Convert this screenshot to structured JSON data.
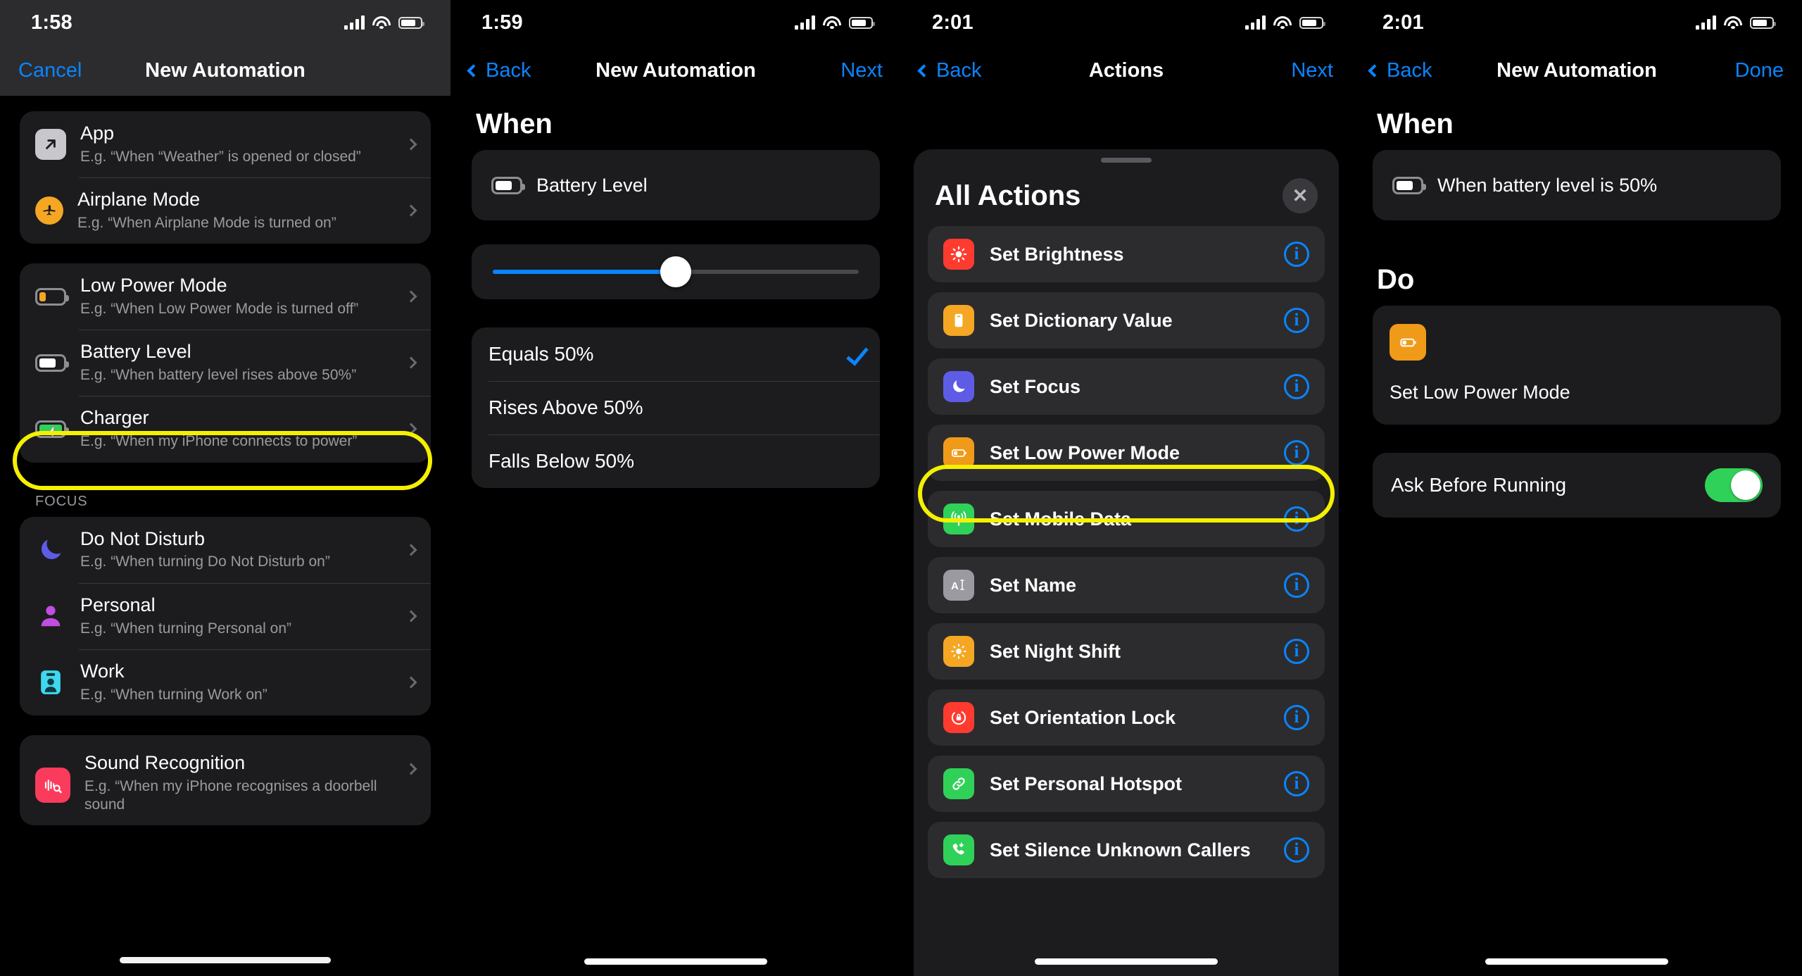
{
  "panels": [
    {
      "status": {
        "time": "1:58"
      },
      "nav": {
        "left": "Cancel",
        "title": "New Automation",
        "right": ""
      },
      "groups": [
        {
          "header": "",
          "rows": [
            {
              "icon": "arrow-up-right-square-icon",
              "title": "App",
              "sub": "E.g. “When “Weather” is opened or closed”"
            },
            {
              "icon": "airplane-icon",
              "title": "Airplane Mode",
              "sub": "E.g. “When Airplane Mode is turned on”"
            }
          ]
        },
        {
          "header": "",
          "rows": [
            {
              "icon": "battery-low-icon",
              "title": "Low Power Mode",
              "sub": "E.g. “When Low Power Mode is turned off”"
            },
            {
              "icon": "battery-level-icon",
              "title": "Battery Level",
              "sub": "E.g. “When battery level rises above 50%”",
              "highlighted": true
            },
            {
              "icon": "battery-charging-icon",
              "title": "Charger",
              "sub": "E.g. “When my iPhone connects to power”"
            }
          ]
        },
        {
          "header": "FOCUS",
          "rows": [
            {
              "icon": "moon-icon",
              "title": "Do Not Disturb",
              "sub": "E.g. “When turning Do Not Disturb on”"
            },
            {
              "icon": "person-icon",
              "title": "Personal",
              "sub": "E.g. “When turning Personal on”"
            },
            {
              "icon": "id-card-icon",
              "title": "Work",
              "sub": "E.g. “When turning Work on”"
            }
          ]
        },
        {
          "header": "",
          "rows": [
            {
              "icon": "waveform-magnifier-icon",
              "title": "Sound Recognition",
              "sub": "E.g. “When my iPhone recognises a doorbell sound"
            }
          ]
        }
      ]
    },
    {
      "status": {
        "time": "1:59"
      },
      "nav": {
        "left": "Back",
        "title": "New Automation",
        "right": "Next"
      },
      "section_title": "When",
      "trigger": {
        "icon": "battery-level-icon",
        "label": "Battery Level"
      },
      "slider": {
        "value": 50,
        "min": 0,
        "max": 100
      },
      "options": [
        {
          "label": "Equals 50%",
          "selected": true
        },
        {
          "label": "Rises Above 50%",
          "selected": false
        },
        {
          "label": "Falls Below 50%",
          "selected": false
        }
      ]
    },
    {
      "status": {
        "time": "2:01"
      },
      "nav": {
        "left": "Back",
        "title": "Actions",
        "right": "Next"
      },
      "sheet": {
        "title": "All Actions",
        "close_label": "✕",
        "actions": [
          {
            "label": "Set Brightness",
            "icon": "brightness-icon",
            "color": "#ff3b30",
            "info": "i"
          },
          {
            "label": "Set Dictionary Value",
            "icon": "dictionary-icon",
            "color": "#f5a623",
            "info": "i"
          },
          {
            "label": "Set Focus",
            "icon": "moon-icon",
            "color": "#5e5ce6",
            "info": "i"
          },
          {
            "label": "Set Low Power Mode",
            "icon": "battery-low-icon",
            "color": "#f09a1a",
            "info": "i",
            "highlighted": true
          },
          {
            "label": "Set Mobile Data",
            "icon": "antenna-icon",
            "color": "#30d158",
            "info": "i"
          },
          {
            "label": "Set Name",
            "icon": "text-cursor-icon",
            "color": "#9a9aa0",
            "info": "i"
          },
          {
            "label": "Set Night Shift",
            "icon": "night-shift-icon",
            "color": "#f5a623",
            "info": "i"
          },
          {
            "label": "Set Orientation Lock",
            "icon": "rotation-lock-icon",
            "color": "#ff3b30",
            "info": "i"
          },
          {
            "label": "Set Personal Hotspot",
            "icon": "link-icon",
            "color": "#30d158",
            "info": "i"
          },
          {
            "label": "Set Silence Unknown Callers",
            "icon": "phone-down-icon",
            "color": "#30d158",
            "info": "i"
          }
        ]
      }
    },
    {
      "status": {
        "time": "2:01"
      },
      "nav": {
        "left": "Back",
        "title": "New Automation",
        "right": "Done"
      },
      "when": {
        "heading": "When",
        "icon": "battery-level-icon",
        "label": "When battery level is 50%"
      },
      "do": {
        "heading": "Do",
        "icon": "battery-low-icon",
        "label": "Set Low Power Mode"
      },
      "ask": {
        "label": "Ask Before Running",
        "on": true
      }
    }
  ],
  "colors": {
    "accent_blue": "#0a84ff",
    "highlight_yellow": "#f5f000",
    "toggle_green": "#30d158",
    "card_bg": "#1c1c1e",
    "sheet_row_bg": "#2c2c2e"
  }
}
